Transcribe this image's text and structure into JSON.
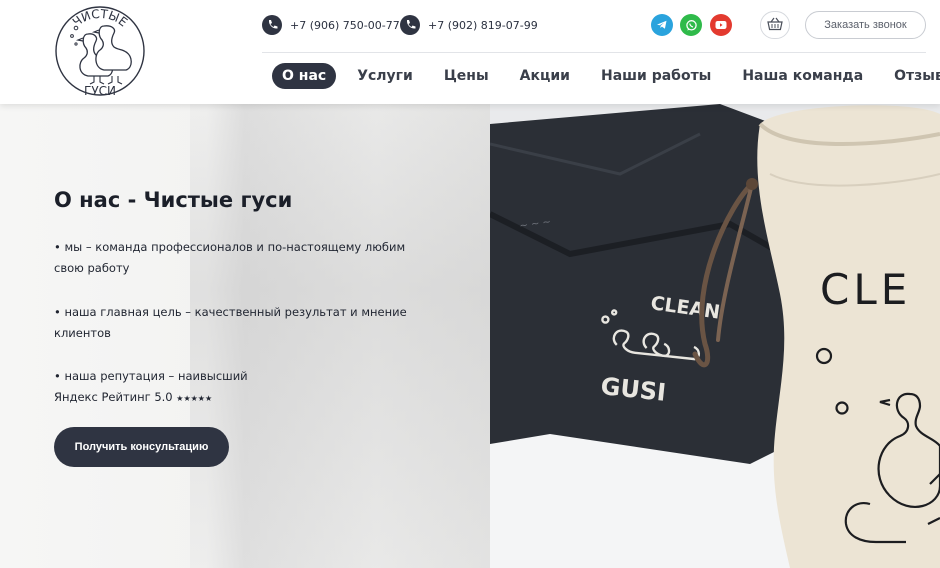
{
  "logo": {
    "top_text": "ЧИСТЫЕ",
    "bottom_text": "ГУСИ"
  },
  "contacts": {
    "phone1": "+7 (906) 750-00-77",
    "phone2": "+7 (902) 819-07-99"
  },
  "social": {
    "icons": [
      "telegram-icon",
      "whatsapp-icon",
      "youtube-icon"
    ],
    "colors": {
      "telegram": "#2aa3dd",
      "whatsapp": "#2fba4a",
      "youtube": "#e33a2f"
    }
  },
  "header": {
    "callback_label": "Заказать звонок"
  },
  "nav": {
    "items": [
      {
        "label": "О нас",
        "active": true
      },
      {
        "label": "Услуги",
        "active": false
      },
      {
        "label": "Цены",
        "active": false
      },
      {
        "label": "Акции",
        "active": false
      },
      {
        "label": "Наши работы",
        "active": false
      },
      {
        "label": "Наша команда",
        "active": false
      },
      {
        "label": "Отзывы",
        "active": false
      }
    ]
  },
  "hero": {
    "title": "О нас - Чистые гуси",
    "bullets": [
      "• мы – команда профессионалов и по-настоящему любим свою работу",
      "• наша главная цель – качественный результат и мнение клиентов",
      "• наша репутация – наивысший"
    ],
    "rating_line": "Яндекс Рейтинг 5.0",
    "rating_stars": "★★★★★",
    "button_label": "Получить консультацию"
  },
  "photo": {
    "bag_text": "CLE",
    "bag2_top_text": "CLEAN",
    "bag2_bottom_text": "GUSI"
  },
  "theme": {
    "accent": "#2f3442"
  }
}
